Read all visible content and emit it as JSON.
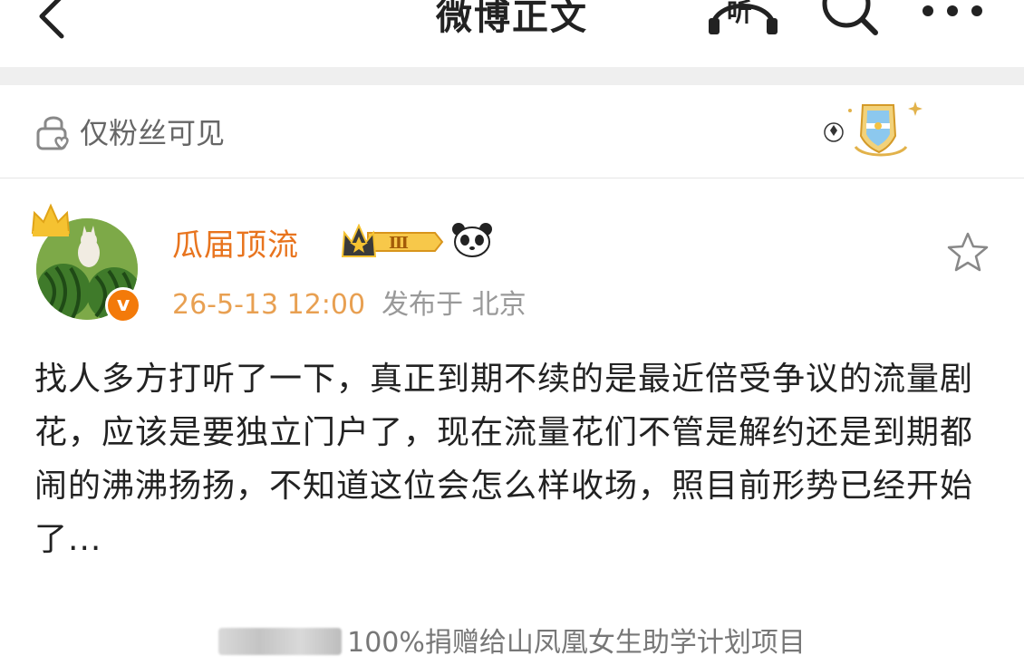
{
  "header": {
    "back_icon": "chevron-left-icon",
    "title": "微博正文",
    "listen_label": "听",
    "search_icon": "search-icon",
    "more_icon": "more-dots-icon"
  },
  "visibility": {
    "icon": "lock-heart-icon",
    "label": "仅粉丝可见",
    "badge": "argentina-football-badge"
  },
  "post": {
    "author": {
      "name": "瓜届顶流",
      "verified_icon": "verified-v-icon",
      "crown_icon": "crown-icon",
      "vip_level": "Ⅲ",
      "emoji_icon": "panda-icon"
    },
    "time": "26-5-13 12:00",
    "location": "发布于 北京",
    "favorite_icon": "star-icon",
    "content": "找人多方打听了一下，真正到期不续的是最近倍受争议的流量剧花，应该是要独立门户了，现在流量花们不管是解约还是到期都闹的沸沸扬扬，不知道这位会怎么样收场，照目前形势已经开始了..."
  },
  "footer": {
    "text": "100%捐赠给山凤凰女生助学计划项目"
  },
  "colors": {
    "username": "#e8741e",
    "time": "#e8a052",
    "verify": "#f37a0a",
    "gap": "#efefef"
  }
}
